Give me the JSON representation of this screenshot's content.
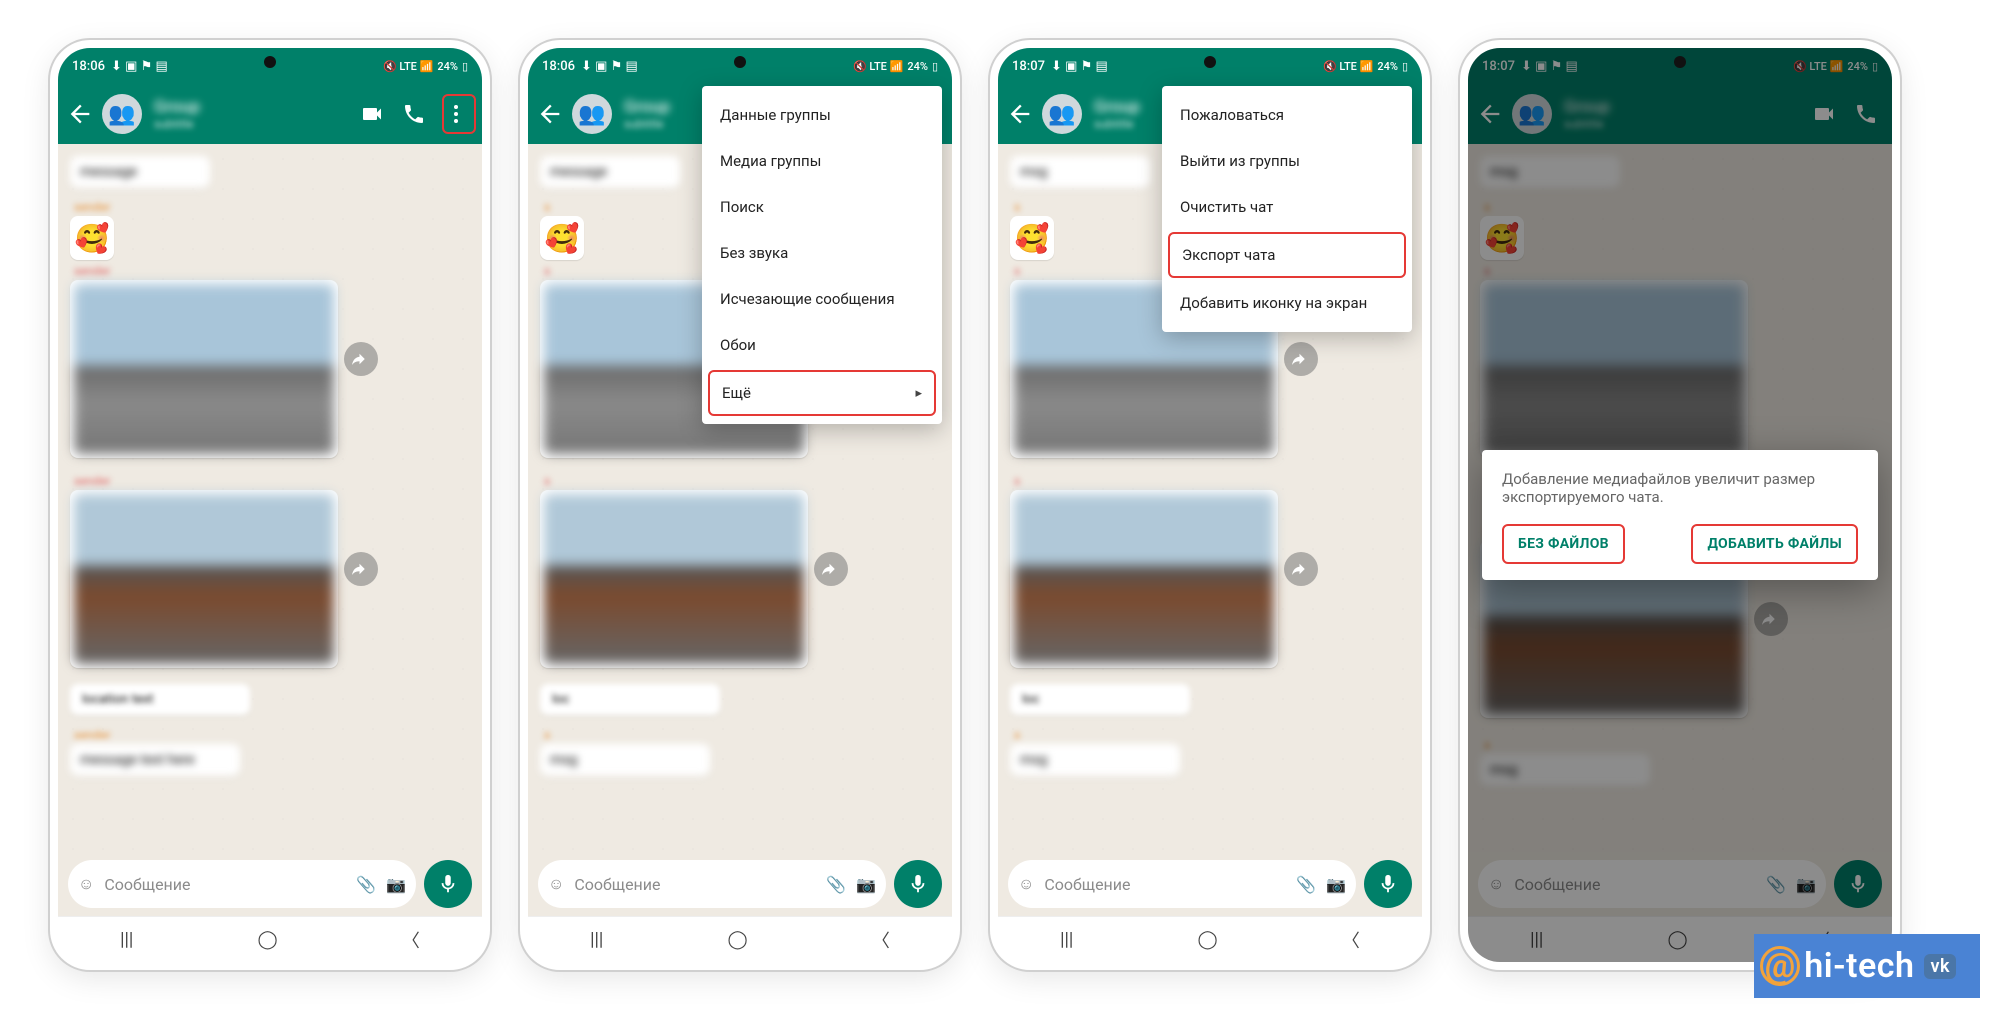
{
  "phones": [
    {
      "time": "18:06",
      "battery": "24%"
    },
    {
      "time": "18:06",
      "battery": "24%"
    },
    {
      "time": "18:07",
      "battery": "24%"
    },
    {
      "time": "18:07",
      "battery": "24%"
    }
  ],
  "input": {
    "placeholder": "Сообщение"
  },
  "menu1": {
    "items": [
      "Данные группы",
      "Медиа группы",
      "Поиск",
      "Без звука",
      "Исчезающие сообщения",
      "Обои",
      "Ещё"
    ]
  },
  "menu2": {
    "items": [
      "Пожаловаться",
      "Выйти из группы",
      "Очистить чат",
      "Экспорт чата",
      "Добавить иконку на экран"
    ]
  },
  "dialog": {
    "message": "Добавление медиафайлов увеличит размер экспортируемого чата.",
    "btn_no": "БЕЗ ФАЙЛОВ",
    "btn_yes": "ДОБАВИТЬ ФАЙЛЫ"
  },
  "watermark": {
    "text": "hi-tech"
  }
}
